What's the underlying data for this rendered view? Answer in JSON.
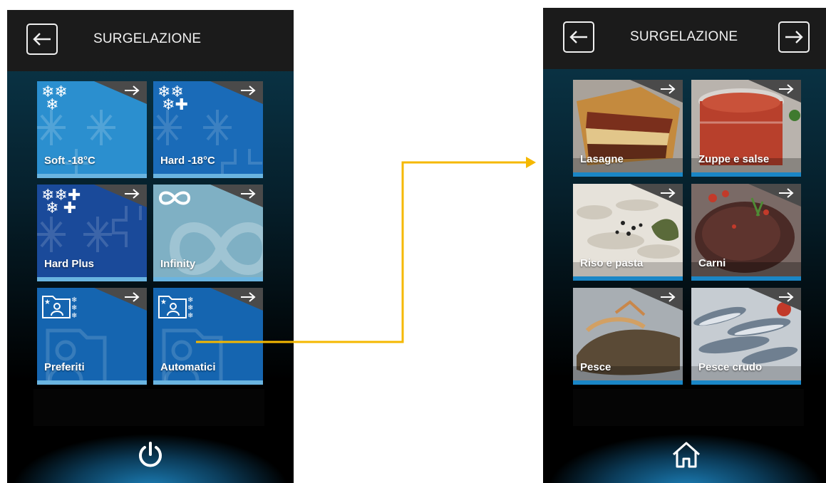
{
  "left_screen": {
    "title": "SURGELAZIONE",
    "tiles": [
      {
        "label": "Soft -18°C",
        "color": "#2b8fcf"
      },
      {
        "label": "Hard -18°C",
        "color": "#1a6bb8"
      },
      {
        "label": "Hard Plus",
        "color": "#1a4a9a"
      },
      {
        "label": "Infinity",
        "color": "#7fb0c4"
      },
      {
        "label": "Preferiti",
        "color": "#1565b0"
      },
      {
        "label": "Automatici",
        "color": "#1565b0"
      }
    ],
    "footer_icon": "power-icon"
  },
  "right_screen": {
    "title": "SURGELAZIONE",
    "tiles": [
      {
        "label": "Lasagne"
      },
      {
        "label": "Zuppe e salse"
      },
      {
        "label": "Riso e pasta"
      },
      {
        "label": "Carni"
      },
      {
        "label": "Pesce"
      },
      {
        "label": "Pesce crudo"
      }
    ],
    "footer_icon": "home-icon"
  },
  "connector_color": "#f5b800"
}
